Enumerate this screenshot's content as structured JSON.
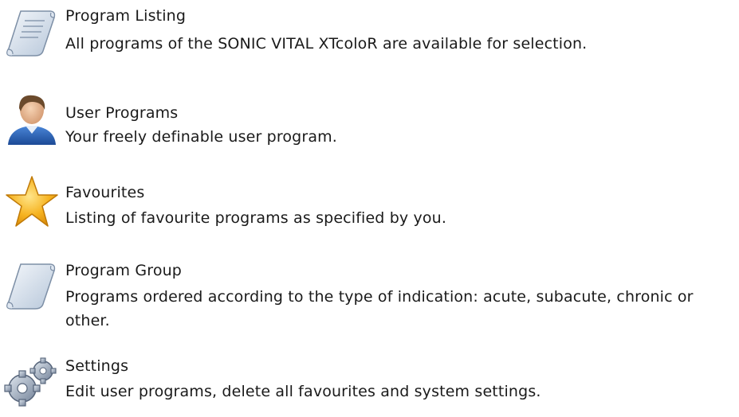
{
  "items": [
    {
      "icon": "scroll-document-icon",
      "title": "Program Listing",
      "description": "All programs of the SONIC VITAL XTcoloR are available for selection."
    },
    {
      "icon": "user-avatar-icon",
      "title": "User Programs",
      "description": "Your freely definable user program."
    },
    {
      "icon": "star-icon",
      "title": "Favourites",
      "description": "Listing of favourite programs as specified by you."
    },
    {
      "icon": "scroll-icon",
      "title": "Program Group",
      "description": "Programs ordered according to the type of indication: acute, subacute, chronic or other."
    },
    {
      "icon": "gears-icon",
      "title": "Settings",
      "description": "Edit user programs, delete all favourites and system settings."
    }
  ],
  "colors": {
    "text": "#1a1a1a",
    "scroll": "#c9d6e6",
    "star": "#f5b21a",
    "user_shirt": "#2a62b8",
    "gear": "#8a97a6"
  }
}
